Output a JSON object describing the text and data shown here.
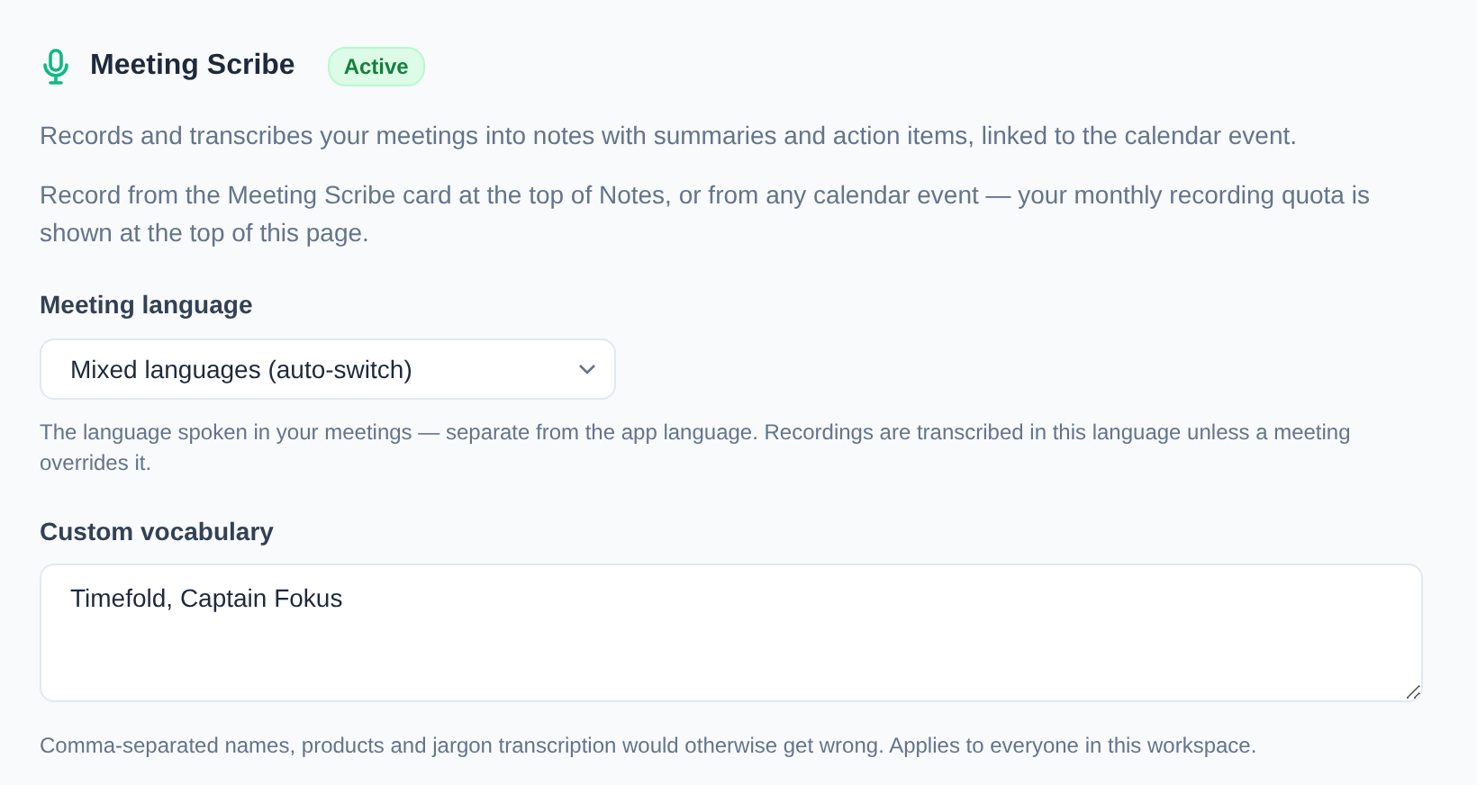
{
  "header": {
    "title": "Meeting Scribe",
    "status": {
      "label": "Active",
      "kind": "active"
    }
  },
  "description": "Records and transcribes your meetings into notes with summaries and action items, linked to the calendar event.",
  "note": "Record from the Meeting Scribe card at the top of Notes, or from any calendar event — your monthly recording quota is shown at the top of this page.",
  "fields": [
    {
      "kind": "select",
      "label": "Meeting language",
      "value": "Mixed languages (auto-switch)",
      "help": "The language spoken in your meetings — separate from the app language. Recordings are transcribed in this language unless a meeting overrides it."
    },
    {
      "kind": "textarea",
      "label": "Custom vocabulary",
      "value": "Timefold, Captain Fokus",
      "help": "Comma-separated names, products and jargon transcription would otherwise get wrong. Applies to everyone in this workspace."
    }
  ]
}
